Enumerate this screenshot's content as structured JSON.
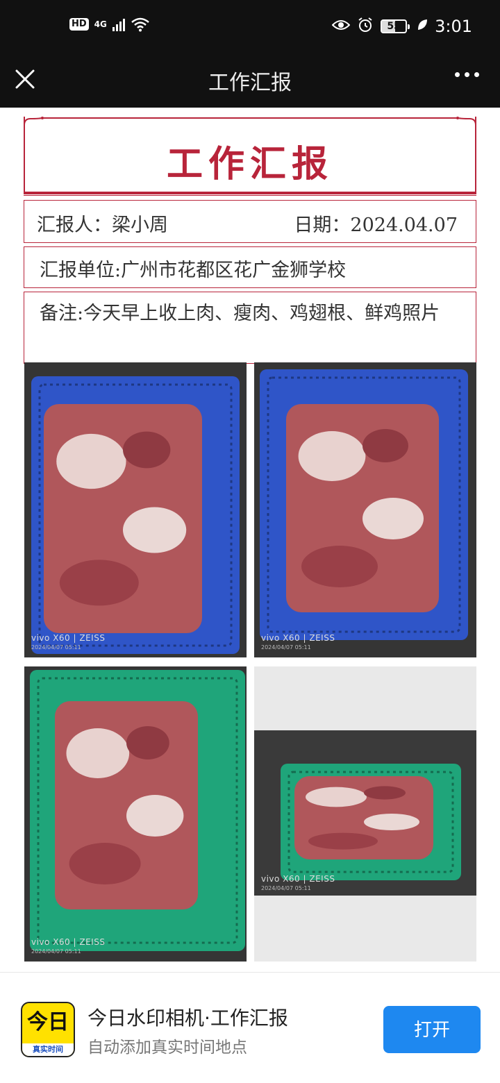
{
  "status_bar": {
    "hd": "HD",
    "network": "4G",
    "battery": "55",
    "time": "3:01",
    "icons": [
      "signal-icon",
      "wifi-icon",
      "eye-icon",
      "alarm-icon",
      "battery-icon",
      "leaf-icon"
    ]
  },
  "nav": {
    "title": "工作汇报",
    "close_icon": "close-icon",
    "more_icon": "more-icon"
  },
  "report": {
    "title": "工作汇报",
    "reporter": "汇报人：梁小周",
    "date": "日期：2024.04.07",
    "unit": "汇报单位:广州市花都区花广金狮学校",
    "note": "备注:今天早上收上肉、瘦肉、鸡翅根、鲜鸡照片",
    "accent_color": "#b8243a"
  },
  "photos": [
    {
      "crate_color": "#2f55c8",
      "brand": "vivo X60 | ZEISS",
      "timestamp": "2024/04/07 05:11"
    },
    {
      "crate_color": "#2f55c8",
      "brand": "vivo X60 | ZEISS",
      "timestamp": "2024/04/07 05:11"
    },
    {
      "crate_color": "#1fa57a",
      "brand": "vivo X60 | ZEISS",
      "timestamp": "2024/04/07 05:11"
    },
    {
      "crate_color": "#1fa57a",
      "brand": "vivo X60 | ZEISS",
      "timestamp": "2024/04/07 05:11"
    }
  ],
  "banner": {
    "app_icon_big": "今日",
    "app_icon_small": "真实时间",
    "title": "今日水印相机·工作汇报",
    "subtitle": "自动添加真实时间地点",
    "open_label": "打开",
    "button_color": "#1e88f0"
  }
}
